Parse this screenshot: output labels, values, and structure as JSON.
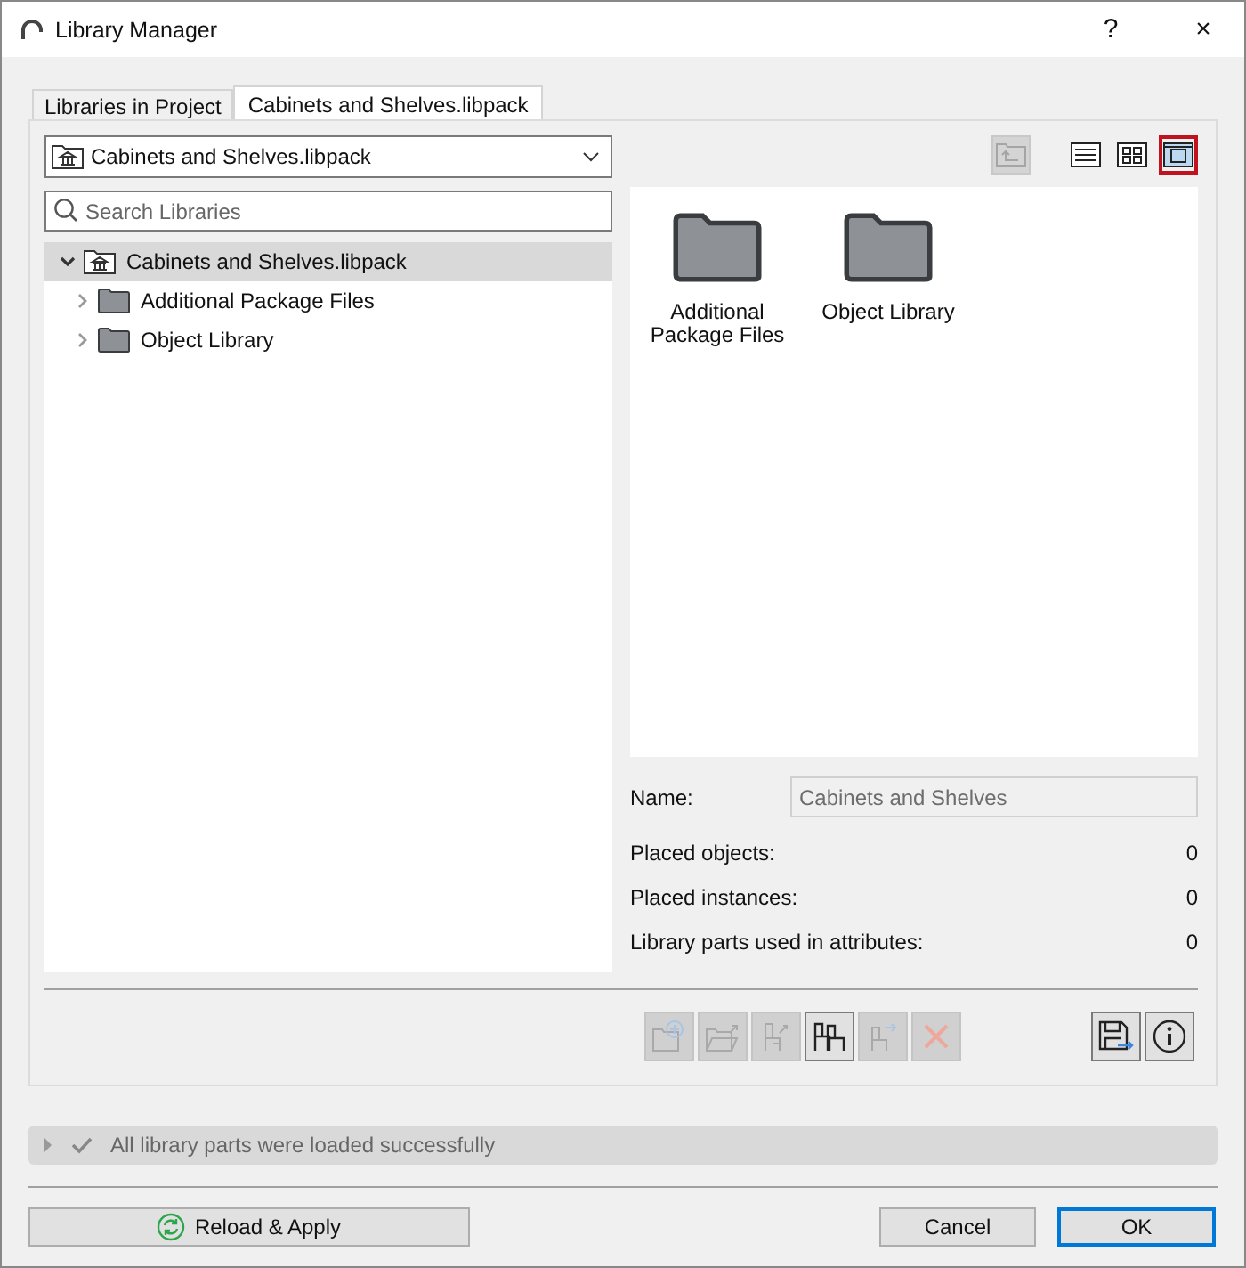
{
  "window": {
    "title": "Library Manager",
    "help": "?",
    "close": "×"
  },
  "tabs": [
    {
      "label": "Libraries in Project",
      "selected": false
    },
    {
      "label": "Cabinets and Shelves.libpack",
      "selected": true
    }
  ],
  "library_dropdown": {
    "value": "Cabinets and Shelves.libpack"
  },
  "search": {
    "placeholder": "Search Libraries"
  },
  "tree": [
    {
      "label": "Cabinets and Shelves.libpack",
      "kind": "library",
      "expanded": true,
      "selected": true,
      "children": [
        {
          "label": "Additional Package Files",
          "kind": "folder",
          "expanded": false,
          "selected": false
        },
        {
          "label": "Object Library",
          "kind": "folder",
          "expanded": false,
          "selected": false
        }
      ]
    }
  ],
  "up_button": {
    "disabled": true
  },
  "view_buttons": [
    {
      "kind": "list",
      "selected": false
    },
    {
      "kind": "grid",
      "selected": false
    },
    {
      "kind": "preview",
      "selected": true
    }
  ],
  "preview_items": [
    {
      "label": "Additional Package Files"
    },
    {
      "label": "Object Library"
    }
  ],
  "name_field": {
    "label": "Name:",
    "value": "Cabinets and Shelves",
    "disabled": true
  },
  "stats": [
    {
      "label": "Placed objects:",
      "value": "0"
    },
    {
      "label": "Placed instances:",
      "value": "0"
    },
    {
      "label": "Library parts used in attributes:",
      "value": "0"
    }
  ],
  "action_buttons": [
    {
      "kind": "folder-plus",
      "disabled": true
    },
    {
      "kind": "folder-arrow",
      "disabled": true
    },
    {
      "kind": "chair-arrow",
      "disabled": true
    },
    {
      "kind": "chairs",
      "disabled": false
    },
    {
      "kind": "chair-right",
      "disabled": true
    },
    {
      "kind": "delete",
      "disabled": true
    }
  ],
  "side_buttons": [
    {
      "kind": "save",
      "disabled": false
    },
    {
      "kind": "info",
      "disabled": false
    }
  ],
  "status": {
    "message": "All library parts were loaded successfully",
    "expanded": false
  },
  "footer": {
    "reload": "Reload & Apply",
    "cancel": "Cancel",
    "ok": "OK"
  }
}
